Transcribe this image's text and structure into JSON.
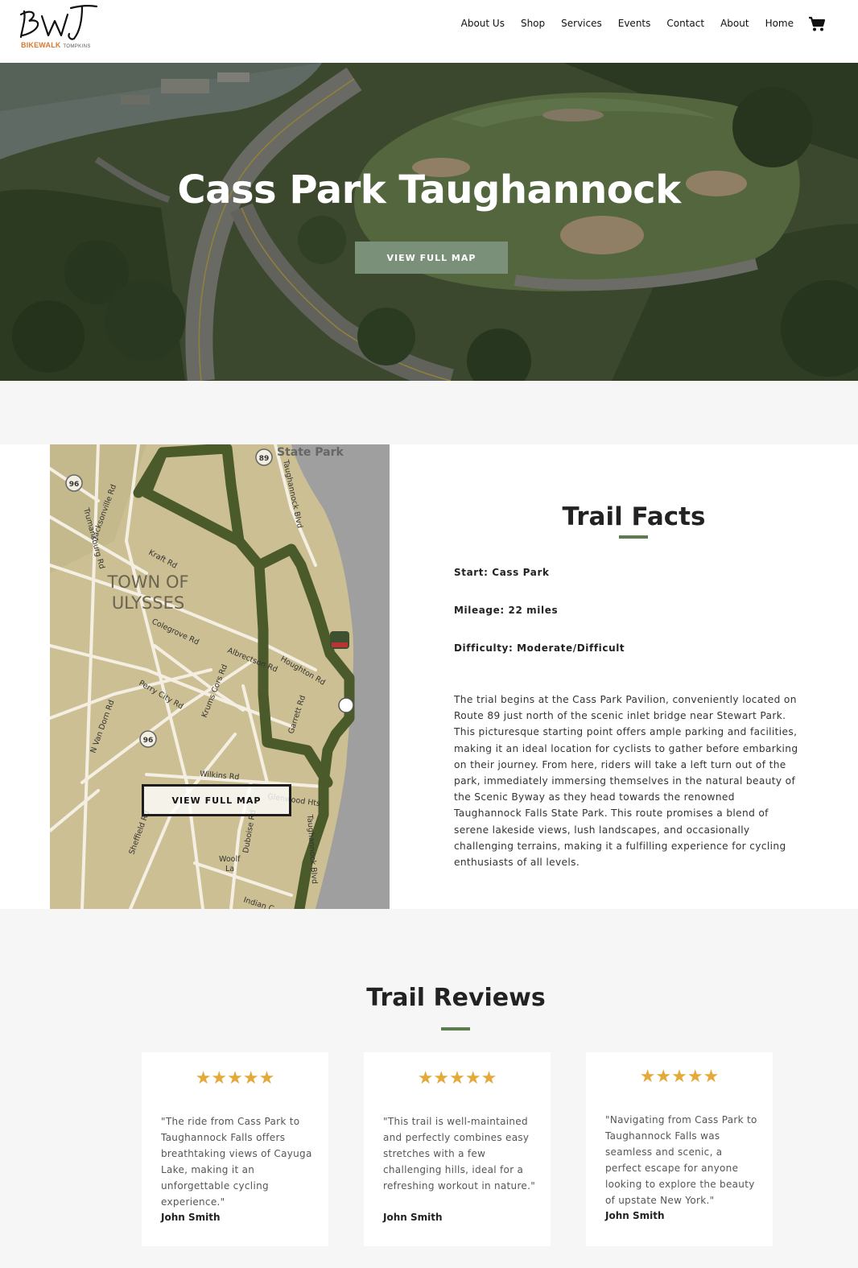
{
  "header": {
    "logo_sub_primary": "BIKEWALK",
    "logo_sub_secondary": "TOMPKINS",
    "nav": [
      "About Us",
      "Shop",
      "Services",
      "Events",
      "Contact",
      "About",
      "Home"
    ]
  },
  "hero": {
    "title": "Cass Park Taughannock",
    "button_label": "VIEW FULL MAP"
  },
  "trail": {
    "map_button_label": "VIEW FULL MAP",
    "facts_title": "Trail Facts",
    "start": "Start: Cass Park",
    "mileage": "Mileage: 22 miles",
    "difficulty": "Difficulty: Moderate/Difficult",
    "description": "The trial begins at the Cass Park Pavilion, conveniently located on Route 89 just north of the scenic inlet bridge near Stewart Park. This picturesque starting point offers ample parking and facilities, making it an ideal location for cyclists to gather before embarking on their journey. From here, riders will take a left turn out of the park, immediately immersing themselves in the natural beauty of the Scenic Byway as they head towards the renowned Taughannock Falls State Park. This route promises a blend of serene lakeside views, lush landscapes, and occasionally challenging terrains, making it a fulfilling experience for cycling enthusiasts of all levels.",
    "map_labels": {
      "state_park": "State Park",
      "town": "TOWN OF",
      "town2": "ULYSSES",
      "route96a": "96",
      "route89": "89",
      "route96b": "96",
      "jacksonville": "Jacksonville Rd",
      "trumansburg": "Trumansburg Rd",
      "kraft": "Kraft Rd",
      "colegrove": "Colegrove Rd",
      "albrectson": "Albrectson Rd",
      "houghton": "Houghton Rd",
      "perry": "Perry City Rd",
      "krums": "Krums Cors Rd",
      "garrett": "Garrett Rd",
      "vandorn": "N Van Dorn Rd",
      "wilkins": "Wilkins Rd",
      "glenwood": "Glenwood Hts",
      "sheffield": "Sheffield Rd",
      "duboise": "Duboise Rd",
      "woolf": "Woolf",
      "woolf2": "La",
      "taughannock_blvd": "Taughannock Blvd",
      "taughannock_blvd2": "Taughannock Blvd",
      "indian": "Indian C"
    }
  },
  "reviews": {
    "title": "Trail Reviews",
    "items": [
      {
        "stars": "★★★★★",
        "text": "\"The ride from Cass Park to Taughannock Falls offers breathtaking views of Cayuga Lake, making it an unforgettable cycling experience.\"",
        "author": "John Smith"
      },
      {
        "stars": "★★★★★",
        "text": "\"This trail is well-maintained and perfectly combines easy stretches with a few challenging hills, ideal for a refreshing workout in nature.\"",
        "author": "John Smith"
      },
      {
        "stars": "★★★★★",
        "text": "\"Navigating from Cass Park to Taughannock Falls was seamless and scenic, a perfect escape for anyone looking to explore the beauty of upstate New York.\"",
        "author": "John Smith"
      }
    ]
  }
}
